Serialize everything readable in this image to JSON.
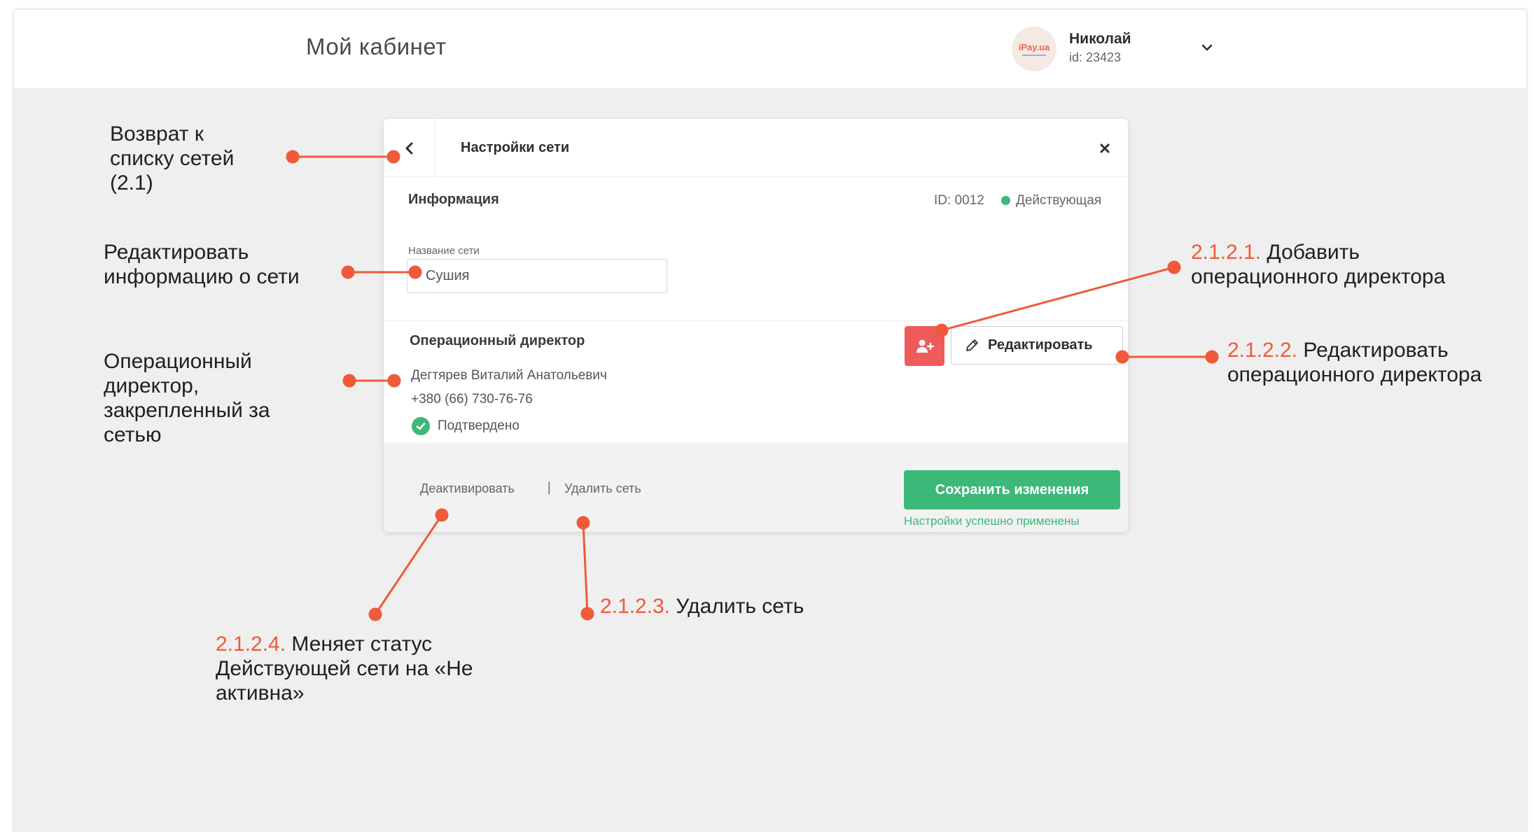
{
  "header": {
    "title": "Мой кабинет",
    "avatar_text": "iPay.ua",
    "user_name": "Николай",
    "user_id": "id: 23423"
  },
  "modal": {
    "title": "Настройки сети",
    "info": {
      "heading": "Информация",
      "id": "ID: 0012",
      "status": "Действующая",
      "field_label": "Название сети",
      "field_value": "Сушия"
    },
    "director": {
      "heading": "Операционный директор",
      "name": "Дегтярев Виталий Анатольевич",
      "phone": "+380 (66) 730-76-76",
      "confirmed": "Подтвердено",
      "edit_label": "Редактировать"
    },
    "footer": {
      "deactivate": "Деактивировать",
      "separator": "|",
      "delete": "Удалить сеть",
      "save": "Сохранить изменения",
      "success": "Настройки успешно применены"
    }
  },
  "annotations": {
    "back": [
      "Возврат к",
      "списку сетей",
      "(2.1)"
    ],
    "edit_info": [
      "Редактировать",
      "информацию о сети"
    ],
    "director": [
      "Операционный",
      "директор,",
      "закрепленный за",
      "сетью"
    ],
    "add_director": {
      "num": "2.1.2.1.",
      "line1": "Добавить",
      "line2": "операционного директора"
    },
    "edit_director": {
      "num": "2.1.2.2.",
      "line1": "Редактировать",
      "line2": "операционного директора"
    },
    "delete": {
      "num": "2.1.2.3.",
      "line1": "Удалить сеть"
    },
    "deactivate": {
      "num": "2.1.2.4.",
      "line1": "Меняет статус",
      "line2": "Действующей сети на «Не",
      "line3": "активна»"
    }
  },
  "colors": {
    "accent_green": "#3cb878",
    "accent_red": "#ef5a5a",
    "callout": "#ee5a3a"
  }
}
